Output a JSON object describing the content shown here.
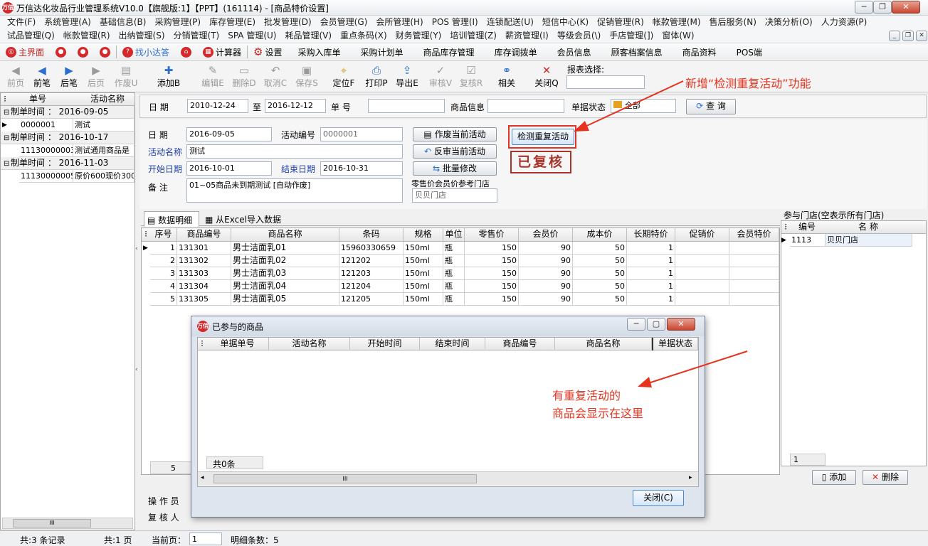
{
  "window": {
    "title": "万信达化妆品行业管理系统V10.0【旗舰版:1】【PPT】(161114) - [商品特价设置]",
    "logo": "万信"
  },
  "menu": {
    "row1": [
      "文件(F)",
      "系统管理(A)",
      "基础信息(B)",
      "采购管理(P)",
      "库存管理(E)",
      "批发管理(D)",
      "会员管理(G)",
      "会所管理(H)",
      "POS 管理(I)",
      "连锁配送(U)",
      "短信中心(K)",
      "促销管理(R)",
      "帐款管理(M)",
      "售后服务(N)",
      "决策分析(O)",
      "人力资源(P)"
    ],
    "row2": [
      "试品管理(Q)",
      "帐款管理(R)",
      "出纳管理(S)",
      "分销管理(T)",
      "SPA 管理(U)",
      "耗品管理(V)",
      "重点条码(X)",
      "财务管理(Y)",
      "培训管理(Z)",
      "薪资管理(I)",
      "等级会员(\\)",
      "手店管理(])",
      "窗体(W)"
    ]
  },
  "quickbar": [
    "主界面",
    "找小达答",
    "计算器",
    "设置",
    "采购入库单",
    "采购计划单",
    "商品库存管理",
    "库存调拨单",
    "会员信息",
    "顾客档案信息",
    "商品资料",
    "POS端"
  ],
  "toolbar": {
    "buttons": [
      {
        "label": "前页",
        "icon": "◀",
        "enabled": false
      },
      {
        "label": "前笔",
        "icon": "◀",
        "enabled": true
      },
      {
        "label": "后笔",
        "icon": "▶",
        "enabled": true
      },
      {
        "label": "后页",
        "icon": "▶",
        "enabled": false
      },
      {
        "label": "作废U",
        "icon": "▤",
        "enabled": false
      },
      {
        "label": "添加B",
        "icon": "✚",
        "enabled": true
      },
      {
        "label": "编辑E",
        "icon": "✎",
        "enabled": false
      },
      {
        "label": "删除D",
        "icon": "▭",
        "enabled": false
      },
      {
        "label": "取消C",
        "icon": "↶",
        "enabled": false
      },
      {
        "label": "保存S",
        "icon": "▣",
        "enabled": false
      },
      {
        "label": "定位F",
        "icon": "⌖",
        "enabled": true
      },
      {
        "label": "打印P",
        "icon": "⎙",
        "enabled": true
      },
      {
        "label": "导出E",
        "icon": "⇪",
        "enabled": true
      },
      {
        "label": "审核V",
        "icon": "✓",
        "enabled": false
      },
      {
        "label": "复核R",
        "icon": "☑",
        "enabled": false
      },
      {
        "label": "相关",
        "icon": "⚭",
        "enabled": true
      },
      {
        "label": "关闭Q",
        "icon": "✕",
        "enabled": true
      }
    ],
    "report_label": "报表选择:"
  },
  "left": {
    "headers": [
      "单号",
      "活动名称"
    ],
    "groups": [
      {
        "label": "制单时间 ： 2016-09-05",
        "rows": [
          [
            "0000001",
            "测试"
          ]
        ]
      },
      {
        "label": "制单时间 ： 2016-10-17",
        "rows": [
          [
            "11130000003",
            "测试通用商品是"
          ]
        ]
      },
      {
        "label": "制单时间 ： 2016-11-03",
        "rows": [
          [
            "11130000005",
            "原价600现价300"
          ]
        ]
      }
    ],
    "scroll_mark": "III"
  },
  "filter": {
    "date_label": "日  期",
    "date_from": "2010-12-24",
    "to_label": "至",
    "date_to": "2016-12-12",
    "order_label": "单  号",
    "order_value": "",
    "product_label": "商品信息",
    "product_value": "",
    "status_label": "单据状态",
    "status_value": "全部",
    "query_button": "查 询"
  },
  "form": {
    "date_label": "日  期",
    "date": "2016-09-05",
    "code_label": "活动编号",
    "code": "0000001",
    "name_label": "活动名称",
    "name": "测试",
    "start_label": "开始日期",
    "start": "2016-10-01",
    "end_label": "结束日期",
    "end": "2016-10-31",
    "remark_label": "备  注",
    "remark": "01~05商品未到期测试 [自动作废]",
    "ref_label": "零售价会员价参考门店",
    "ref_store": "贝贝门店",
    "void_button": "作废当前活动",
    "unaudit_button": "反审当前活动",
    "batch_button": "批量修改",
    "check_button": "检测重复活动",
    "stamp": "已复核"
  },
  "annotations": {
    "top": "新增“检测重复活动”功能",
    "bottom_line1": "有重复活动的",
    "bottom_line2": "商品会显示在这里"
  },
  "tabs": {
    "detail": "数据明细",
    "excel": "从Excel导入数据"
  },
  "detail": {
    "headers": [
      "序号",
      "商品编号",
      "商品名称",
      "条码",
      "规格",
      "单位",
      "零售价",
      "会员价",
      "成本价",
      "长期特价",
      "促销价",
      "会员特价"
    ],
    "rows": [
      [
        "1",
        "131301",
        "男士洁面乳01",
        "15960330659",
        "150ml",
        "瓶",
        "150",
        "90",
        "50",
        "1",
        "",
        ""
      ],
      [
        "2",
        "131302",
        "男士洁面乳02",
        "121202",
        "150ml",
        "瓶",
        "150",
        "90",
        "50",
        "1",
        "",
        ""
      ],
      [
        "3",
        "131303",
        "男士洁面乳03",
        "121203",
        "150ml",
        "瓶",
        "150",
        "90",
        "50",
        "1",
        "",
        ""
      ],
      [
        "4",
        "131304",
        "男士洁面乳04",
        "121204",
        "150ml",
        "瓶",
        "150",
        "90",
        "50",
        "1",
        "",
        ""
      ],
      [
        "5",
        "131305",
        "男士洁面乳05",
        "121205",
        "150ml",
        "瓶",
        "150",
        "90",
        "50",
        "1",
        "",
        ""
      ]
    ],
    "footer_count": "5"
  },
  "stores": {
    "title": "参与门店(空表示所有门店)",
    "headers": [
      "编号",
      "名 称"
    ],
    "rows": [
      [
        "1113",
        "贝贝门店"
      ]
    ],
    "footer": "1",
    "add_button": "添加",
    "delete_button": "删除"
  },
  "bottom": {
    "operator_label": "操 作 员",
    "reviewer_label": "复 核 人"
  },
  "dialog": {
    "title": "已参与的商品",
    "headers": [
      "单据单号",
      "活动名称",
      "开始时间",
      "结束时间",
      "商品编号",
      "商品名称",
      "单据状态"
    ],
    "footer": "共0条",
    "close_button": "关闭(C)",
    "scroll_mark": "III"
  },
  "status": {
    "records": "共:3 条记录",
    "pages": "共:1 页",
    "current_label": "当前页：",
    "current": "1",
    "detail_count": "明细条数：5"
  }
}
